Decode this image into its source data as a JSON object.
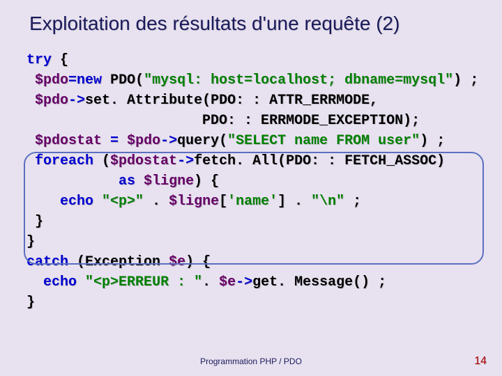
{
  "title": "Exploitation des résultats d'une requête (2)",
  "code": {
    "l1": {
      "try": "try",
      "br": "{"
    },
    "l2": {
      "sp": " ",
      "v": "$pdo",
      "eqnew": "=new",
      "cls": "PDO",
      "op1": "(",
      "s": "\"mysql: host=localhost; dbname=mysql\"",
      "op2": ")",
      "semi": " ;"
    },
    "l3": {
      "sp": " ",
      "v": "$pdo",
      "arr": "->",
      "fn": "set. Attribute",
      "op1": "(",
      "a": "PDO: : ATTR_ERRMODE,",
      "cont": ""
    },
    "l3b": {
      "sp": "                     ",
      "a": "PDO: : ERRMODE_EXCEPTION",
      "op2": ");"
    },
    "l4": {
      "sp": " ",
      "v1": "$pdostat",
      "sp2": " ",
      "eq": "=",
      "sp3": " ",
      "v2": "$pdo",
      "arr": "->",
      "fn": "query",
      "op1": "(",
      "s": "\"SELECT name FROM user\"",
      "op2": ")",
      "semi": " ;"
    },
    "l5": {
      "sp": " ",
      "fe": "foreach",
      "sp2": " (",
      "v": "$pdostat",
      "arr": "->",
      "fn": "fetch. All",
      "op1": "(",
      "a": "PDO: : FETCH_ASSOC",
      "op2": ")"
    },
    "l5b": {
      "sp": "           ",
      "as": "as",
      "sp2": " ",
      "v": "$ligne",
      "op": ") {"
    },
    "l6": {
      "sp": "    ",
      "echo": "echo",
      "sp2": " ",
      "s1": "\"<p>\"",
      "d1": " . ",
      "v": "$ligne",
      "br1": "[",
      "s2": "'name'",
      "br2": "]",
      "d2": " . ",
      "s3": "\"\\n\"",
      "semi": " ;"
    },
    "l7": {
      "sp": " ",
      "cb": "}"
    },
    "l8": {
      "cb": "}"
    },
    "l9": {
      "catch": "catch",
      "sp": " (",
      "cls": "Exception",
      "sp2": " ",
      "v": "$e",
      "op": ") {"
    },
    "l10": {
      "sp": "  ",
      "echo": "echo",
      "sp2": " ",
      "s": "\"<p>ERREUR : \"",
      "d": ". ",
      "v": "$e",
      "arr": "->",
      "fn": "get. Message",
      "op": "()",
      "semi": " ;"
    },
    "l11": {
      "cb": "}"
    }
  },
  "footer": "Programmation PHP / PDO",
  "page": "14"
}
